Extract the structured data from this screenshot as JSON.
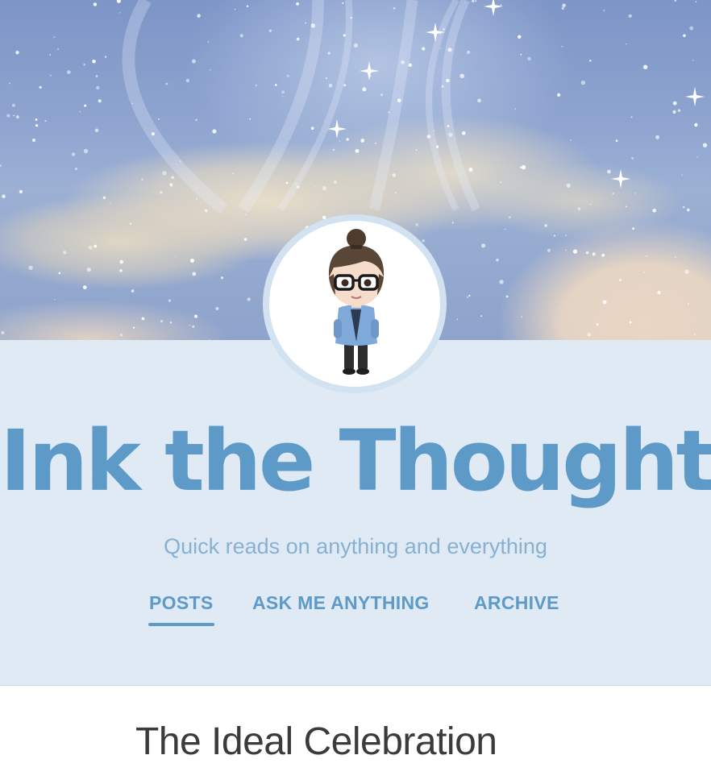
{
  "blog": {
    "title": "Ink the Thought",
    "tagline": "Quick reads on anything and everything",
    "accent_color": "#5e9ac8",
    "panel_color": "#dfeaf4"
  },
  "header": {
    "banner_image": "starry-sky-clouds",
    "avatar": "chibi-avatar-with-glasses"
  },
  "nav": {
    "items": [
      {
        "label": "POSTS",
        "active": true
      },
      {
        "label": "ASK ME ANYTHING",
        "active": false
      },
      {
        "label": "ARCHIVE",
        "active": false
      }
    ]
  },
  "post": {
    "title": "The Ideal Celebration"
  }
}
